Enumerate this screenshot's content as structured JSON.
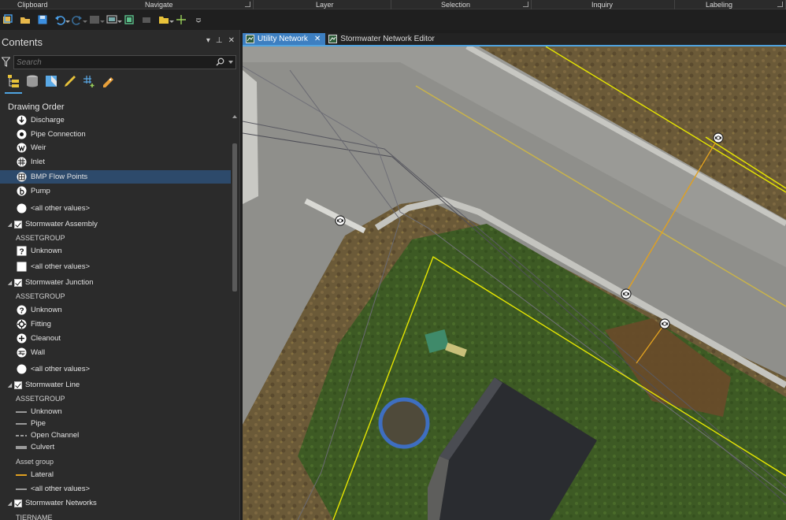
{
  "ribbon": {
    "groups": [
      {
        "label": "Clipboard"
      },
      {
        "label": "Navigate"
      },
      {
        "label": "Layer"
      },
      {
        "label": "Selection"
      },
      {
        "label": "Inquiry"
      },
      {
        "label": "Labeling"
      }
    ]
  },
  "quick_access": {
    "icons": [
      "new-project-icon",
      "open-project-icon",
      "save-project-icon",
      "undo-icon",
      "redo-icon",
      "map-frame-icon",
      "layout-icon",
      "print-icon",
      "share-icon",
      "crosshair-icon",
      "customize-icon"
    ]
  },
  "contents": {
    "title": "Contents",
    "search_placeholder": "Search",
    "drawing_order_label": "Drawing Order",
    "rows": [
      {
        "type": "symbol",
        "label": "Discharge",
        "icon": "discharge-icon"
      },
      {
        "type": "symbol",
        "label": "Pipe Connection",
        "icon": "pipe-connection-icon"
      },
      {
        "type": "symbol",
        "label": "Weir",
        "icon": "weir-icon"
      },
      {
        "type": "symbol",
        "label": "Inlet",
        "icon": "inlet-icon"
      },
      {
        "type": "symbol",
        "label": "BMP Flow Points",
        "icon": "bmp-flow-points-icon",
        "selected": true
      },
      {
        "type": "symbol",
        "label": "Pump",
        "icon": "pump-icon"
      },
      {
        "type": "symbol",
        "label": "<all other values>",
        "icon": "circle-icon"
      },
      {
        "type": "layer",
        "label": "Stormwater Assembly",
        "checked": true
      },
      {
        "type": "header",
        "label": "ASSETGROUP"
      },
      {
        "type": "symbol",
        "label": "Unknown",
        "icon": "question-icon"
      },
      {
        "type": "symbol",
        "label": "<all other values>",
        "icon": "square-icon"
      },
      {
        "type": "layer",
        "label": "Stormwater Junction",
        "checked": true
      },
      {
        "type": "header",
        "label": "ASSETGROUP"
      },
      {
        "type": "symbol",
        "label": "Unknown",
        "icon": "question-circle-icon"
      },
      {
        "type": "symbol",
        "label": "Fitting",
        "icon": "fitting-icon"
      },
      {
        "type": "symbol",
        "label": "Cleanout",
        "icon": "cleanout-icon"
      },
      {
        "type": "symbol",
        "label": "Wall",
        "icon": "wall-icon"
      },
      {
        "type": "symbol",
        "label": "<all other values>",
        "icon": "circle-icon"
      },
      {
        "type": "layer",
        "label": "Stormwater Line",
        "checked": true
      },
      {
        "type": "header",
        "label": "ASSETGROUP"
      },
      {
        "type": "line",
        "label": "Unknown",
        "icon": "line-solid-icon"
      },
      {
        "type": "line",
        "label": "Pipe",
        "icon": "line-solid-icon"
      },
      {
        "type": "line",
        "label": "Open Channel",
        "icon": "line-dashed-icon"
      },
      {
        "type": "line",
        "label": "Culvert",
        "icon": "line-thick-icon"
      },
      {
        "type": "header",
        "label": "Asset group"
      },
      {
        "type": "line",
        "label": "Lateral",
        "icon": "line-orange-icon"
      },
      {
        "type": "line",
        "label": "<all other values>",
        "icon": "line-solid-icon"
      },
      {
        "type": "layer",
        "label": "Stormwater Networks",
        "checked": true
      },
      {
        "type": "header",
        "label": "TIERNAME"
      }
    ]
  },
  "map_tabs": [
    {
      "label": "Utility Network",
      "active": true,
      "closable": true
    },
    {
      "label": "Stormwater Network Editor",
      "active": false,
      "closable": false
    }
  ],
  "colors": {
    "accent": "#4fa3e0",
    "selected_row": "#2d4a6b",
    "lateral_line": "#e0a020",
    "parcel_line": "#e6e600"
  }
}
